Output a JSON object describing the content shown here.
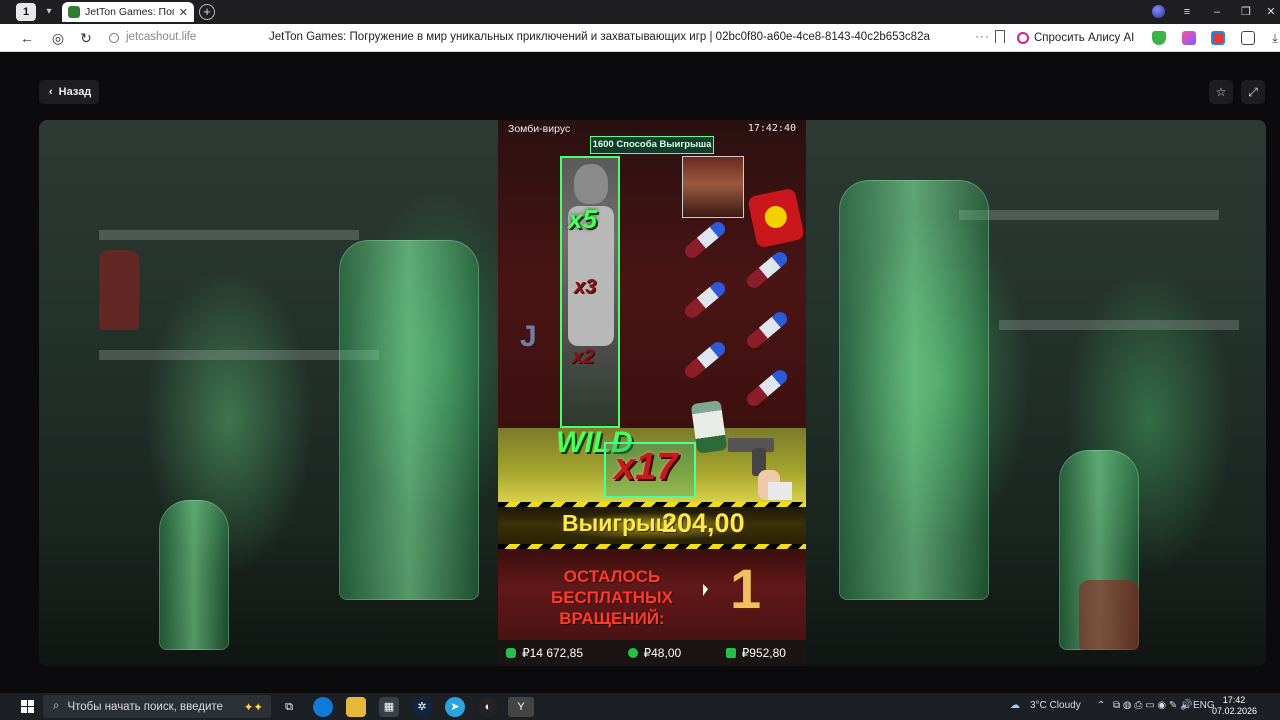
{
  "browser": {
    "tab_count": "1",
    "tab_title": "JetTon Games: Погружение",
    "url": "jetcashout.life",
    "page_heading": "JetTon Games: Погружение в мир уникальных приключений и захватывающих игр | 02bc0f80-a60e-4ce8-8143-40c2b653c82a",
    "alisa_label": "Спросить Алису AI"
  },
  "page": {
    "back_label": "Назад"
  },
  "game": {
    "title": "Зомби-вирус",
    "time": "17:42:40",
    "ways": "1600 Способа Выигрыша",
    "multipliers": [
      "x5",
      "x3",
      "x2"
    ],
    "symbol_j": "J",
    "wild_label": "WILD",
    "wild_multiplier": "x17",
    "win_label": "Выигрыш",
    "win_value": "204,00",
    "free_spins_label": "ОСТАЛОСЬ БЕСПЛАТНЫХ ВРАЩЕНИЙ:",
    "free_spins_count": "1",
    "balance": "₽14 672,85",
    "bet": "₽48,00",
    "total_win": "₽952,80"
  },
  "taskbar": {
    "search_placeholder": "Чтобы начать поиск, введите",
    "weather": "3°C  Cloudy",
    "lang": "ENG",
    "time": "17:42",
    "date": "07.02.2026"
  },
  "colors": {
    "accent_green": "#4dff5a",
    "win_yellow": "#ffe84a",
    "free_spin_red": "#ff3a2a",
    "alisa_pink": "#d81b8c"
  }
}
